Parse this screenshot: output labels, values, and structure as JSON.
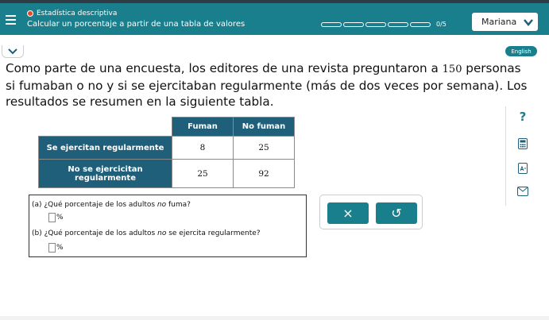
{
  "header": {
    "course": "Estadística descriptiva",
    "subtitle": "Calcular un porcentaje a partir de una tabla de valores",
    "progress_segments": 5,
    "progress_completed": 0,
    "score": "0/5",
    "user_name": "Mariana"
  },
  "language_label": "English",
  "problem": {
    "text_before": "Como parte de una encuesta, los editores de una revista preguntaron a ",
    "number": "150",
    "text_after": " personas si fumaban o no y si se ejercitaban regularmente (más de dos veces por semana). Los resultados se resumen en la siguiente tabla."
  },
  "table": {
    "headers": [
      "Fuman",
      "No fuman"
    ],
    "rows": [
      {
        "label": "Se ejercitan regularmente",
        "values": [
          "8",
          "25"
        ]
      },
      {
        "label": "No se ejercicitan regularmente",
        "values": [
          "25",
          "92"
        ]
      }
    ]
  },
  "questions": {
    "a_pre": "(a) ¿Qué porcentaje de los adultos ",
    "a_em": "no",
    "a_post": " fuma?",
    "b_pre": "(b) ¿Qué porcentaje de los adultos ",
    "b_em": "no",
    "b_post": " se ejercita regularmente?",
    "unit": "%"
  },
  "actions": {
    "clear_symbol": "×",
    "undo_symbol": "↺"
  },
  "sidebar": {
    "help_symbol": "?"
  },
  "colors": {
    "accent": "#1a7f8c",
    "table_header": "#1f5f7a",
    "status_dot": "#e8462a"
  }
}
